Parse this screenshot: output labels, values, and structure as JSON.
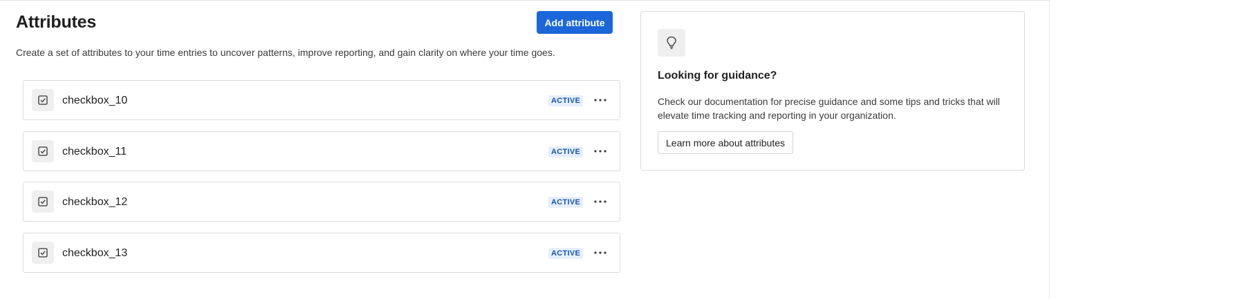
{
  "page": {
    "title": "Attributes",
    "description": "Create a set of attributes to your time entries to uncover patterns, improve reporting, and gain clarity on where your time goes.",
    "add_button_label": "Add attribute"
  },
  "attributes": [
    {
      "name": "checkbox_10",
      "status": "ACTIVE",
      "type_icon": "checkbox-icon"
    },
    {
      "name": "checkbox_11",
      "status": "ACTIVE",
      "type_icon": "checkbox-icon"
    },
    {
      "name": "checkbox_12",
      "status": "ACTIVE",
      "type_icon": "checkbox-icon"
    },
    {
      "name": "checkbox_13",
      "status": "ACTIVE",
      "type_icon": "checkbox-icon"
    }
  ],
  "guidance": {
    "icon": "lightbulb-icon",
    "title": "Looking for guidance?",
    "text": "Check our documentation for precise guidance and some tips and tricks that will elevate time tracking and reporting in your organization.",
    "button_label": "Learn more about attributes"
  },
  "colors": {
    "primary": "#1b67d9",
    "badge_bg": "#e6efff",
    "badge_text": "#1754b5"
  }
}
